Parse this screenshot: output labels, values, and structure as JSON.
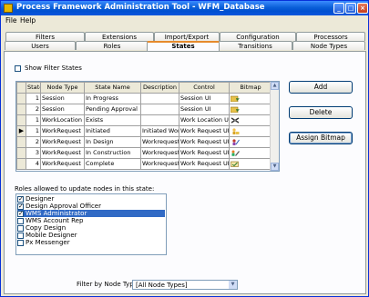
{
  "window": {
    "title": "Process Framework Administration Tool - WFM_Database",
    "controls": {
      "minimize": "_",
      "maximize": "□",
      "close": "×"
    }
  },
  "menu": [
    "File",
    "Help"
  ],
  "tabs": {
    "row1": [
      "Filters",
      "Extensions",
      "Import/Export",
      "Configuration",
      "Processors"
    ],
    "row2": [
      "Users",
      "Roles",
      "States",
      "Transitions",
      "Node Types"
    ],
    "active": "States"
  },
  "show_filter_states": {
    "label": "Show Filter States",
    "checked": false
  },
  "grid": {
    "columns": [
      "State",
      "Node Type",
      "State Name",
      "Description",
      "Control",
      "Bitmap"
    ],
    "current_row_marker": "▶",
    "rows": [
      {
        "state": "1",
        "node_type": "Session",
        "name": "In Progress",
        "description": "",
        "control": "Session UI",
        "bitmap": "folder-arrow-icon"
      },
      {
        "state": "2",
        "node_type": "Session",
        "name": "Pending Approval",
        "description": "",
        "control": "Session UI",
        "bitmap": "folder-arrow-icon"
      },
      {
        "state": "1",
        "node_type": "WorkLocation",
        "name": "Exists",
        "description": "",
        "control": "Work Location UI",
        "bitmap": "tools-icon"
      },
      {
        "state": "1",
        "node_type": "WorkRequest",
        "name": "Initiated",
        "description": "Initiated Work",
        "control": "Work Request UI",
        "bitmap": "person-icon",
        "current": true
      },
      {
        "state": "2",
        "node_type": "WorkRequest",
        "name": "In Design",
        "description": "Workrequest i",
        "control": "Work Request UI",
        "bitmap": "design-icon"
      },
      {
        "state": "3",
        "node_type": "WorkRequest",
        "name": "In Construction",
        "description": "Workrequest i",
        "control": "Work Request UI",
        "bitmap": "construction-icon"
      },
      {
        "state": "4",
        "node_type": "WorkRequest",
        "name": "Complete",
        "description": "Workrequest I",
        "control": "Work Request UI",
        "bitmap": "complete-icon"
      }
    ]
  },
  "buttons": {
    "add": "Add",
    "delete": "Delete",
    "assign_bitmap": "Assign Bitmap"
  },
  "roles": {
    "label": "Roles allowed to update nodes in this state:",
    "items": [
      {
        "name": "Designer",
        "checked": true,
        "highlighted": false
      },
      {
        "name": "Design Approval Officer",
        "checked": true,
        "highlighted": false
      },
      {
        "name": "WMS Administrator",
        "checked": true,
        "highlighted": true
      },
      {
        "name": "WMS Account Rep",
        "checked": false,
        "highlighted": false
      },
      {
        "name": "Copy Design",
        "checked": false,
        "highlighted": false
      },
      {
        "name": "Mobile Designer",
        "checked": false,
        "highlighted": false
      },
      {
        "name": "Px Messenger",
        "checked": false,
        "highlighted": false
      }
    ]
  },
  "filter": {
    "label": "Filter by Node Type:",
    "value": "[All Node Types]"
  },
  "colors": {
    "title_bar": "#0a5fd8",
    "selection": "#316ac5",
    "active_tab_accent": "#e68b2c"
  }
}
